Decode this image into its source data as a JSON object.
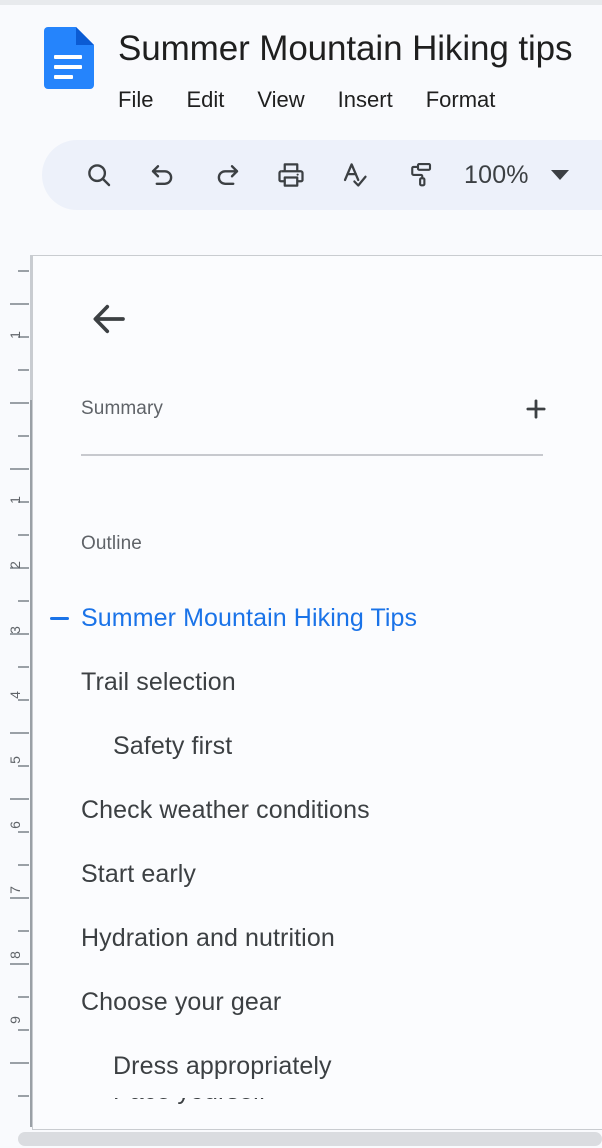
{
  "app": {
    "doc_icon_name": "google-docs-icon",
    "title": "Summer Mountain Hiking tips"
  },
  "menubar": {
    "items": [
      {
        "label": "File"
      },
      {
        "label": "Edit"
      },
      {
        "label": "View"
      },
      {
        "label": "Insert"
      },
      {
        "label": "Format"
      }
    ]
  },
  "toolbar": {
    "buttons": [
      {
        "name": "search-icon",
        "tooltip": "Search"
      },
      {
        "name": "undo-icon",
        "tooltip": "Undo"
      },
      {
        "name": "redo-icon",
        "tooltip": "Redo"
      },
      {
        "name": "print-icon",
        "tooltip": "Print"
      },
      {
        "name": "spellcheck-icon",
        "tooltip": "Spelling and grammar check"
      },
      {
        "name": "paint-format-icon",
        "tooltip": "Paint format"
      }
    ],
    "zoom_value": "100%"
  },
  "ruler": {
    "numbers": [
      "1",
      "1",
      "2",
      "3",
      "4",
      "5",
      "6",
      "7",
      "8",
      "9"
    ]
  },
  "panel": {
    "back_label": "Back",
    "summary_label": "Summary",
    "add_summary_label": "Add summary",
    "outline_label": "Outline"
  },
  "outline": {
    "items": [
      {
        "label": "Summer Mountain Hiking Tips",
        "level": 1,
        "active": true,
        "collapsible": true
      },
      {
        "label": "Trail selection",
        "level": 1,
        "active": false,
        "collapsible": false
      },
      {
        "label": "Safety first",
        "level": 2,
        "active": false,
        "collapsible": false
      },
      {
        "label": "Check weather conditions",
        "level": 1,
        "active": false,
        "collapsible": false
      },
      {
        "label": "Start early",
        "level": 1,
        "active": false,
        "collapsible": false
      },
      {
        "label": "Hydration and nutrition",
        "level": 1,
        "active": false,
        "collapsible": false
      },
      {
        "label": "Choose your gear",
        "level": 1,
        "active": false,
        "collapsible": false
      },
      {
        "label": "Dress appropriately",
        "level": 2,
        "active": false,
        "collapsible": false
      },
      {
        "label": "Pace yourself",
        "level": 2,
        "active": false,
        "collapsible": false,
        "clipped": true
      }
    ]
  },
  "colors": {
    "accent_blue": "#1a73e8",
    "docs_icon_blue": "#2584fc",
    "toolbar_bg": "#edf1fa",
    "page_bg": "#fbfcfe",
    "text_primary": "#3c4043",
    "text_secondary": "#5f6368",
    "scrollbar_thumb": "#dadce0"
  }
}
